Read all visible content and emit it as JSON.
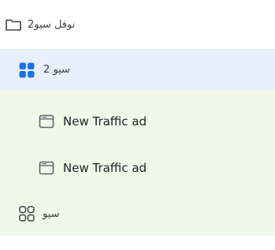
{
  "tree": {
    "campaign": {
      "label": "نوفل سيو2",
      "icon": "folder-icon"
    },
    "ad_group_selected": {
      "label": "سيو 2",
      "icon": "grid-filled-icon",
      "selected": true
    },
    "ads": [
      {
        "label": "New Traffic ad",
        "icon": "window-icon"
      },
      {
        "label": "New Traffic ad",
        "icon": "window-icon"
      }
    ],
    "ad_group_2": {
      "label": "سيو",
      "icon": "grid-outline-icon"
    }
  },
  "colors": {
    "selected_background": "#e8f0fd",
    "group_background": "#f1f8ea",
    "accent_blue": "#1a73e8",
    "icon_gray": "#5f6368",
    "text": "#3c4043"
  }
}
